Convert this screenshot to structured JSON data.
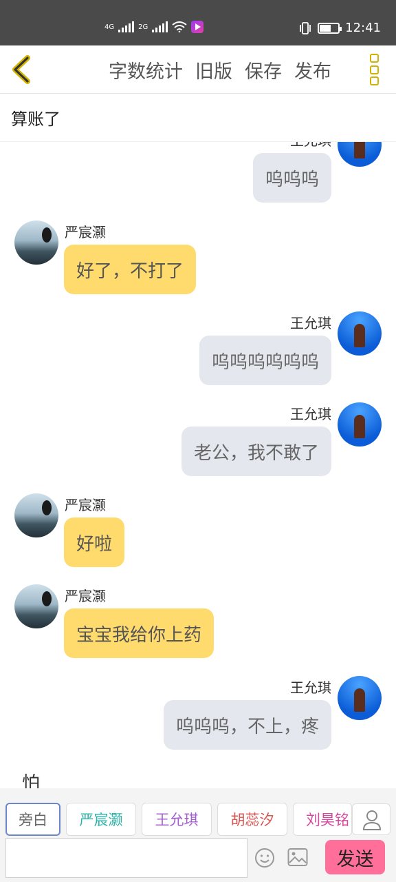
{
  "status_bar": {
    "network_1": "4G",
    "network_2": "2G",
    "time": "12:41",
    "battery_percent": 60
  },
  "toolbar": {
    "actions": [
      "字数统计",
      "旧版",
      "保存",
      "发布"
    ],
    "accent_color": "#d2b200"
  },
  "title": "算账了",
  "chat": {
    "messages": [
      {
        "side": "right",
        "speaker": "王允琪",
        "text": "呜呜呜"
      },
      {
        "side": "left",
        "speaker": "严宸灏",
        "text": "好了，不打了"
      },
      {
        "side": "right",
        "speaker": "王允琪",
        "text": "呜呜呜呜呜呜"
      },
      {
        "side": "right",
        "speaker": "王允琪",
        "text": "老公，我不敢了"
      },
      {
        "side": "left",
        "speaker": "严宸灏",
        "text": "好啦"
      },
      {
        "side": "left",
        "speaker": "严宸灏",
        "text": "宝宝我给你上药"
      },
      {
        "side": "right",
        "speaker": "王允琪",
        "text": "呜呜呜，不上，疼"
      }
    ],
    "narration": "怕"
  },
  "characters": [
    {
      "name": "旁白",
      "color": "#666666",
      "selected": true
    },
    {
      "name": "严宸灏",
      "color": "#2bb3a8",
      "selected": false
    },
    {
      "name": "王允琪",
      "color": "#a35fd0",
      "selected": false
    },
    {
      "name": "胡蕊汐",
      "color": "#d9534f",
      "selected": false
    },
    {
      "name": "刘昊铭",
      "color": "#d6479e",
      "selected": false
    }
  ],
  "input": {
    "value": "",
    "placeholder": "",
    "send_label": "发送",
    "send_color": "#ff6f9a"
  }
}
